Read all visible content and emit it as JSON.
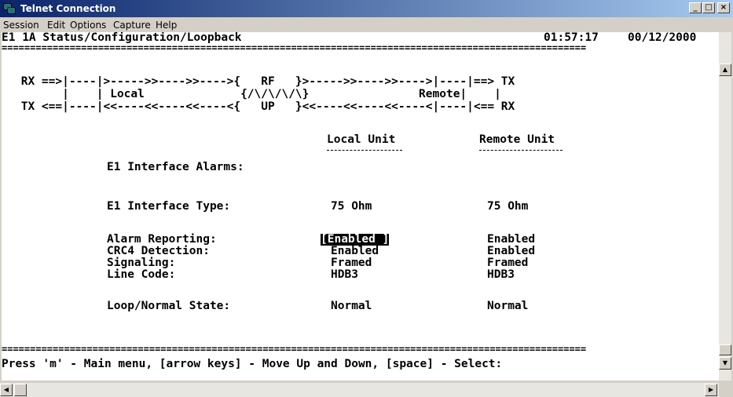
{
  "window": {
    "title": "Telnet Connection",
    "buttons": {
      "minimize": "_",
      "maximize": "□",
      "close": "×"
    }
  },
  "menu": [
    {
      "label": "Session"
    },
    {
      "label": "Edit"
    },
    {
      "label": "Options"
    },
    {
      "label": "Capture"
    },
    {
      "label": "Help"
    }
  ],
  "terminal": {
    "header_title": "E1 1A Status/Configuration/Loopback",
    "time": "01:57:17",
    "date": "00/12/2000",
    "separator": "=======================================================================================================",
    "diagram": {
      "line1": " RX ==>|----|>----->>---->>---->{   RF   }>----->>---->>---->|----|==> TX",
      "line2": "       |    | Local              {/\\/\\/\\/\\}                Remote|    |",
      "line3": " TX <==|----|<<----<<----<<----<{   UP   }<<----<<----<<----<|----|<== RX"
    },
    "columns": {
      "local": "Local Unit",
      "remote": "Remote Unit"
    },
    "rows": [
      {
        "label": "E1 Interface Alarms:",
        "local": "",
        "remote": ""
      },
      {
        "label": "E1 Interface Type:",
        "local": "75 Ohm",
        "remote": "75 Ohm"
      },
      {
        "label": "Alarm Reporting:",
        "local": "[Enabled ]",
        "remote": "Enabled"
      },
      {
        "label": "CRC4 Detection:",
        "local": "Enabled",
        "remote": "Enabled"
      },
      {
        "label": "Signaling:",
        "local": "Framed",
        "remote": "Framed"
      },
      {
        "label": "Line Code:",
        "local": "HDB3",
        "remote": "HDB3"
      },
      {
        "label": "Loop/Normal State:",
        "local": "Normal",
        "remote": "Normal"
      }
    ],
    "footer": "Press 'm' - Main menu, [arrow keys] - Move Up and Down, [space] - Select:"
  },
  "colors": {
    "title_start": "#0a246a",
    "title_end": "#a6caf0",
    "chrome": "#d4d0c8",
    "terminal_bg": "#ffffff",
    "terminal_fg": "#000000"
  },
  "icons": {
    "app": "telnet-app-icon",
    "up": "arrow-up-icon",
    "down": "arrow-down-icon",
    "left": "arrow-left-icon",
    "right": "arrow-right-icon"
  }
}
